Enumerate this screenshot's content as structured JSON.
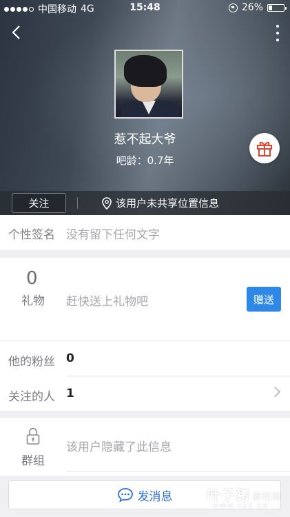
{
  "status_bar": {
    "carrier": "中国移动",
    "network": "4G",
    "time": "15:48",
    "battery_percent": "26%",
    "battery_level": 0.26,
    "signal_bars_filled": 4
  },
  "header": {
    "username": "惹不起大爷",
    "age_label": "吧龄：0.7年",
    "follow_label": "关注",
    "location_text": "该用户未共享位置信息"
  },
  "signature": {
    "label": "个性签名",
    "value": "没有留下任何文字"
  },
  "gifts": {
    "count": "0",
    "label": "礼物",
    "hint": "赶快送上礼物吧",
    "send_label": "赠送"
  },
  "stats": {
    "fans_label": "他的粉丝",
    "fans_value": "0",
    "following_label": "关注的人",
    "following_value": "1"
  },
  "group": {
    "label": "群组",
    "hint": "该用户隐藏了此信息"
  },
  "message_button": {
    "label": "发消息"
  },
  "watermark": {
    "main": "叶子猪",
    "sub": "游戏网",
    "url": "WWW.YZZ.CN"
  },
  "colors": {
    "accent_blue": "#2f87e6",
    "gift_red": "#e0432f",
    "text_gray": "#7c7c80",
    "hint_gray": "#a7a7ab"
  },
  "icons": {
    "back": "back-chevron-icon",
    "more": "more-vertical-icon",
    "gift": "gift-icon",
    "location": "location-pin-icon",
    "lock": "lock-icon",
    "chat": "chat-bubble-icon",
    "chevron": "chevron-right-icon"
  }
}
